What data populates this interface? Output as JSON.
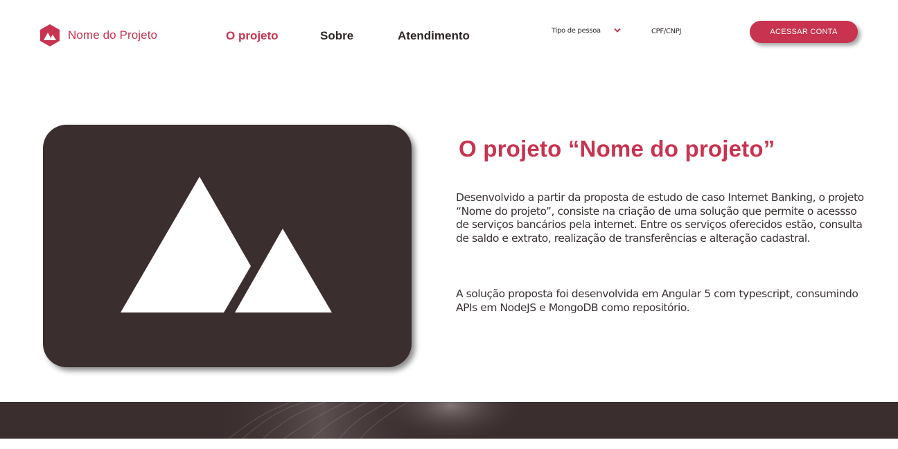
{
  "brand": {
    "name": "Nome do Projeto",
    "logo_icon": "mountain-hexagon-icon",
    "accent_color": "#c8334f",
    "dark_color": "#3b2e2f"
  },
  "nav": {
    "items": [
      {
        "label": "O projeto",
        "active": true
      },
      {
        "label": "Sobre",
        "active": false
      },
      {
        "label": "Atendimento",
        "active": false
      }
    ]
  },
  "login": {
    "person_type_label": "Tipo de pessoa",
    "person_type_icon": "chevron-down-icon",
    "cpf_placeholder": "CPF/CNPJ",
    "access_button_label": "ACESSAR CONTA"
  },
  "hero": {
    "image_icon": "image-placeholder-mountains-icon"
  },
  "content": {
    "title": "O projeto “Nome do projeto”",
    "paragraph1": "Desenvolvido a partir da proposta de estudo de caso Internet Banking, o projeto “Nome do projeto”, consiste na criação de uma solução que permite o acessso de  serviços bancários pela internet. Entre os serviços oferecidos  estão, consulta de saldo e extrato, realização de transferências e alteração cadastral.",
    "paragraph2": "A solução proposta foi desenvolvida em  Angular  5 com typescript, consumindo APIs em NodeJS e MongoDB como repositório."
  }
}
